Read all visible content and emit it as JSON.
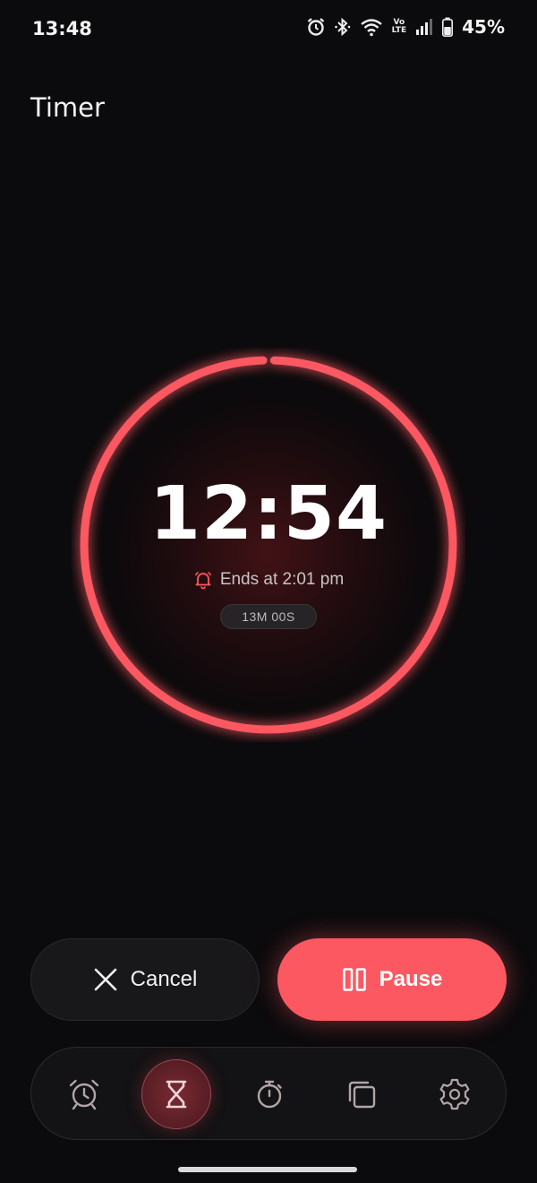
{
  "status_bar": {
    "time": "13:48",
    "network_vo": "Vo",
    "network_lte": "LTE",
    "battery_percent": "45%",
    "icons": [
      "alarm-icon",
      "bluetooth-icon",
      "wifi-icon",
      "volte-icon",
      "signal-icon",
      "battery-icon"
    ]
  },
  "header": {
    "title": "Timer"
  },
  "timer": {
    "remaining": "12:54",
    "ends_at": "Ends at 2:01 pm",
    "duration": "13M 00S",
    "progress_fraction": 0.99,
    "ring_color": "#fb5862"
  },
  "actions": {
    "cancel_label": "Cancel",
    "pause_label": "Pause"
  },
  "bottom_nav": {
    "items": [
      {
        "name": "alarm",
        "icon": "alarm-clock-icon",
        "active": false
      },
      {
        "name": "timer",
        "icon": "hourglass-icon",
        "active": true
      },
      {
        "name": "stopwatch",
        "icon": "stopwatch-icon",
        "active": false
      },
      {
        "name": "world-clock",
        "icon": "layers-icon",
        "active": false
      },
      {
        "name": "settings",
        "icon": "gear-icon",
        "active": false
      }
    ]
  },
  "colors": {
    "accent": "#fb5862",
    "background": "#0b0a0c"
  }
}
